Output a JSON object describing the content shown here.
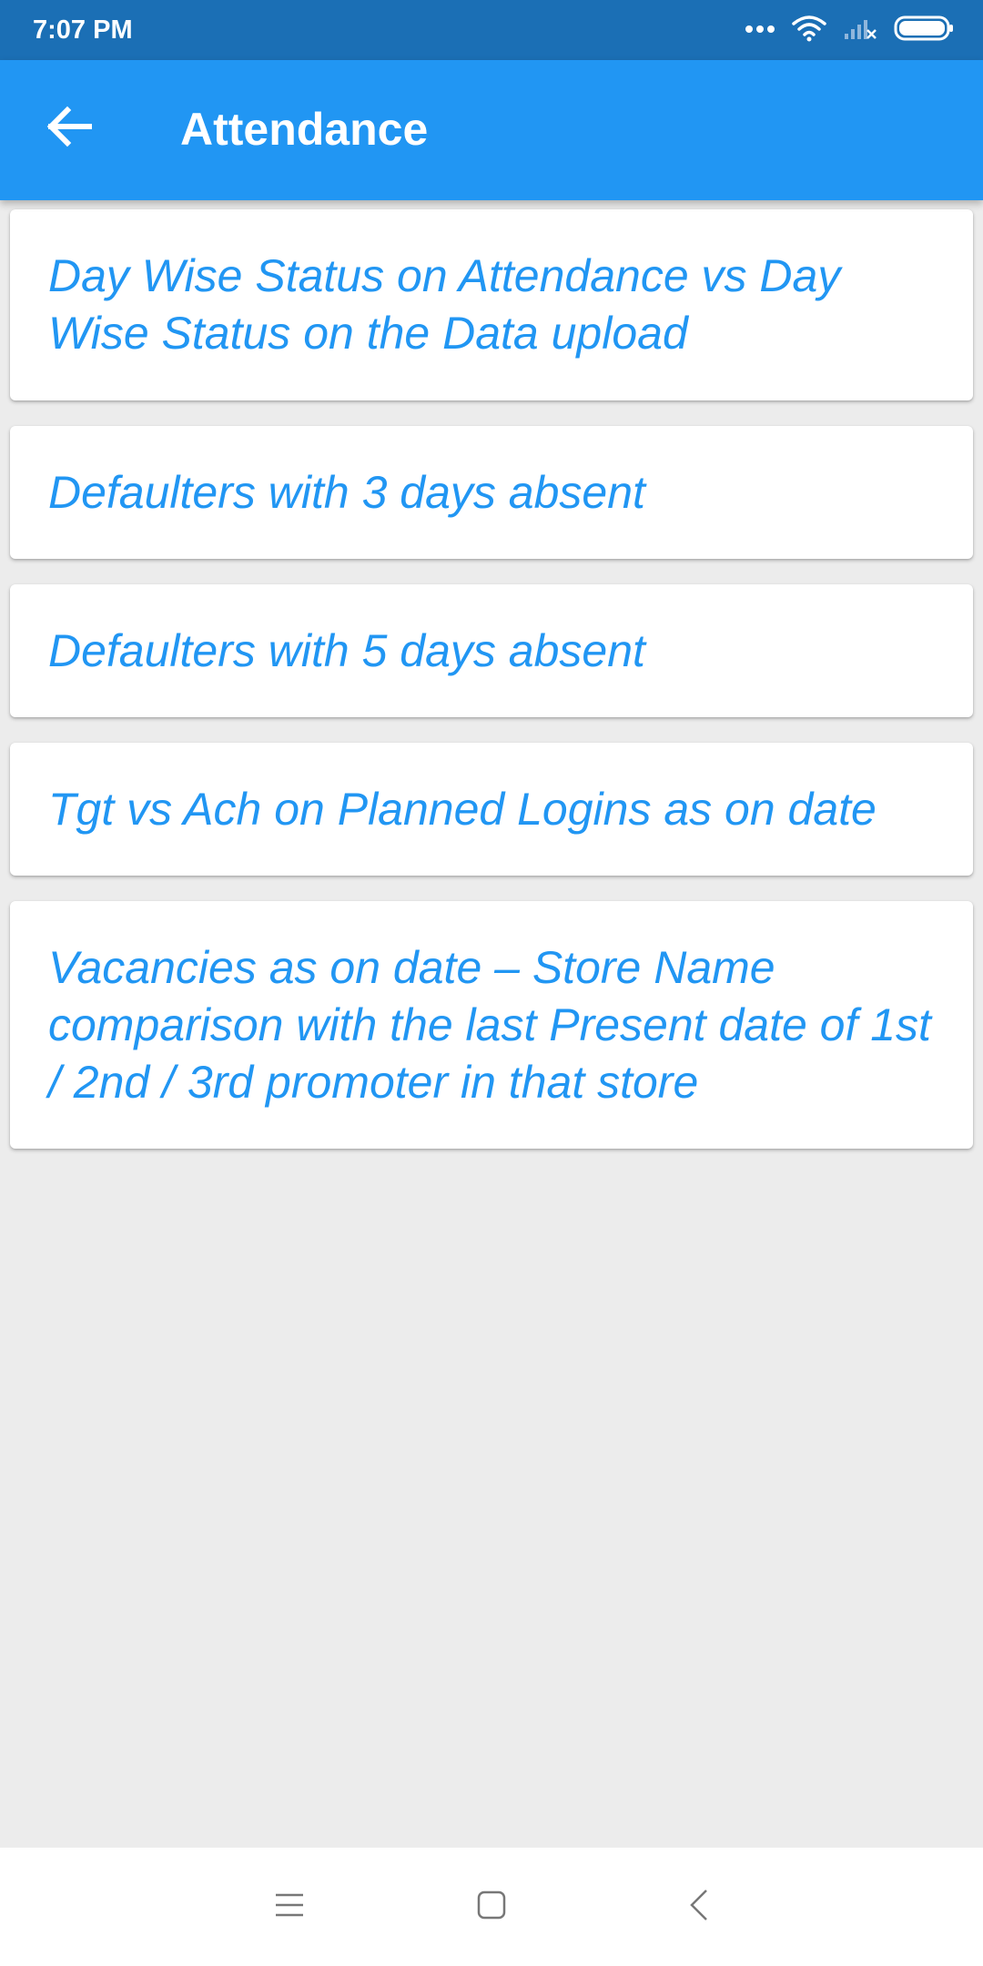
{
  "status_bar": {
    "time": "7:07 PM",
    "icons": [
      "more-dots-icon",
      "wifi-icon",
      "signal-icon",
      "battery-icon"
    ]
  },
  "app_bar": {
    "title": "Attendance",
    "back_icon": "arrow-left-icon"
  },
  "colors": {
    "status_bar": "#1b6fb5",
    "app_bar": "#2196f3",
    "item_text": "#2196f3",
    "background": "#ececec",
    "card": "#ffffff"
  },
  "items": [
    {
      "label": "Day Wise Status on Attendance vs Day Wise Status on the Data upload"
    },
    {
      "label": "Defaulters with 3 days absent"
    },
    {
      "label": "Defaulters with 5 days absent"
    },
    {
      "label": "Tgt vs Ach on Planned Logins as on date"
    },
    {
      "label": "Vacancies as on date – Store Name comparison with the last Present date of 1st / 2nd / 3rd promoter in that store"
    }
  ],
  "nav_bar": {
    "icons": [
      "menu-icon",
      "home-square-icon",
      "back-chevron-icon"
    ]
  }
}
